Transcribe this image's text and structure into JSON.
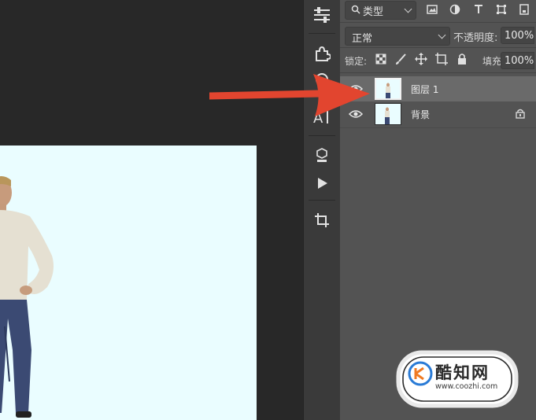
{
  "layers_panel": {
    "filter": {
      "label": "类型",
      "icon": "search-icon"
    },
    "filter_buttons": [
      "image-filter-icon",
      "adjustment-filter-icon",
      "type-filter-icon",
      "shape-filter-icon",
      "smart-object-filter-icon"
    ],
    "blend_mode": "正常",
    "opacity_label": "不透明度:",
    "opacity_value": "100%",
    "lock_label": "锁定:",
    "lock_icons": [
      "lock-transparent-pixels-icon",
      "lock-image-pixels-icon",
      "lock-position-icon",
      "lock-artboard-icon",
      "lock-all-icon"
    ],
    "fill_label": "填充:",
    "fill_value": "100%",
    "layers": [
      {
        "name": "图层 1",
        "selected": true,
        "visible": true,
        "locked": false
      },
      {
        "name": "背景",
        "selected": false,
        "visible": true,
        "locked": true
      }
    ]
  },
  "toolstrip": {
    "tools": [
      "adjustments-icon",
      "plugins-icon",
      "layer-style-icon",
      "character-icon",
      "3d-icon",
      "play-icon",
      "crop-icon"
    ]
  },
  "colors": {
    "panel_bg": "#535353",
    "canvas_bg": "#eafdff",
    "selection_bg": "#6a6a6a",
    "arrow": "#e2452f"
  },
  "watermark": {
    "brand": "酷知网",
    "url": "www.coozhi.com"
  }
}
